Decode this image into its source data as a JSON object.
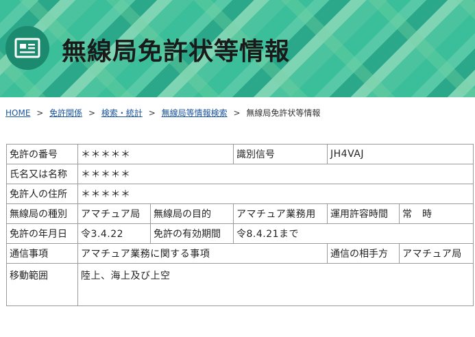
{
  "header": {
    "title": "無線局免許状等情報",
    "icon": "license-card-icon",
    "accent": "#1b8a6e"
  },
  "breadcrumb": {
    "items": [
      "HOME",
      "免許関係",
      "検索・統計",
      "無線局等情報検索"
    ],
    "current": "無線局免許状等情報",
    "separator": ">"
  },
  "table": {
    "license_no_label": "免許の番号",
    "license_no_value": "＊＊＊＊＊",
    "callsign_label": "識別信号",
    "callsign_value": "JH4VAJ",
    "name_label": "氏名又は名称",
    "name_value": "＊＊＊＊＊",
    "address_label": "免許人の住所",
    "address_value": "＊＊＊＊＊",
    "station_type_label": "無線局の種別",
    "station_type_value": "アマチュア局",
    "purpose_label": "無線局の目的",
    "purpose_value": "アマチュア業務用",
    "op_hours_label": "運用許容時間",
    "op_hours_value": "常　時",
    "license_date_label": "免許の年月日",
    "license_date_value": "令3.4.22",
    "validity_label": "免許の有効期間",
    "validity_value": "令8.4.21まで",
    "comm_matters_label": "通信事項",
    "comm_matters_value": "アマチュア業務に関する事項",
    "comm_partner_label": "通信の相手方",
    "comm_partner_value": "アマチュア局",
    "range_label": "移動範囲",
    "range_value": "陸上、海上及び上空"
  }
}
